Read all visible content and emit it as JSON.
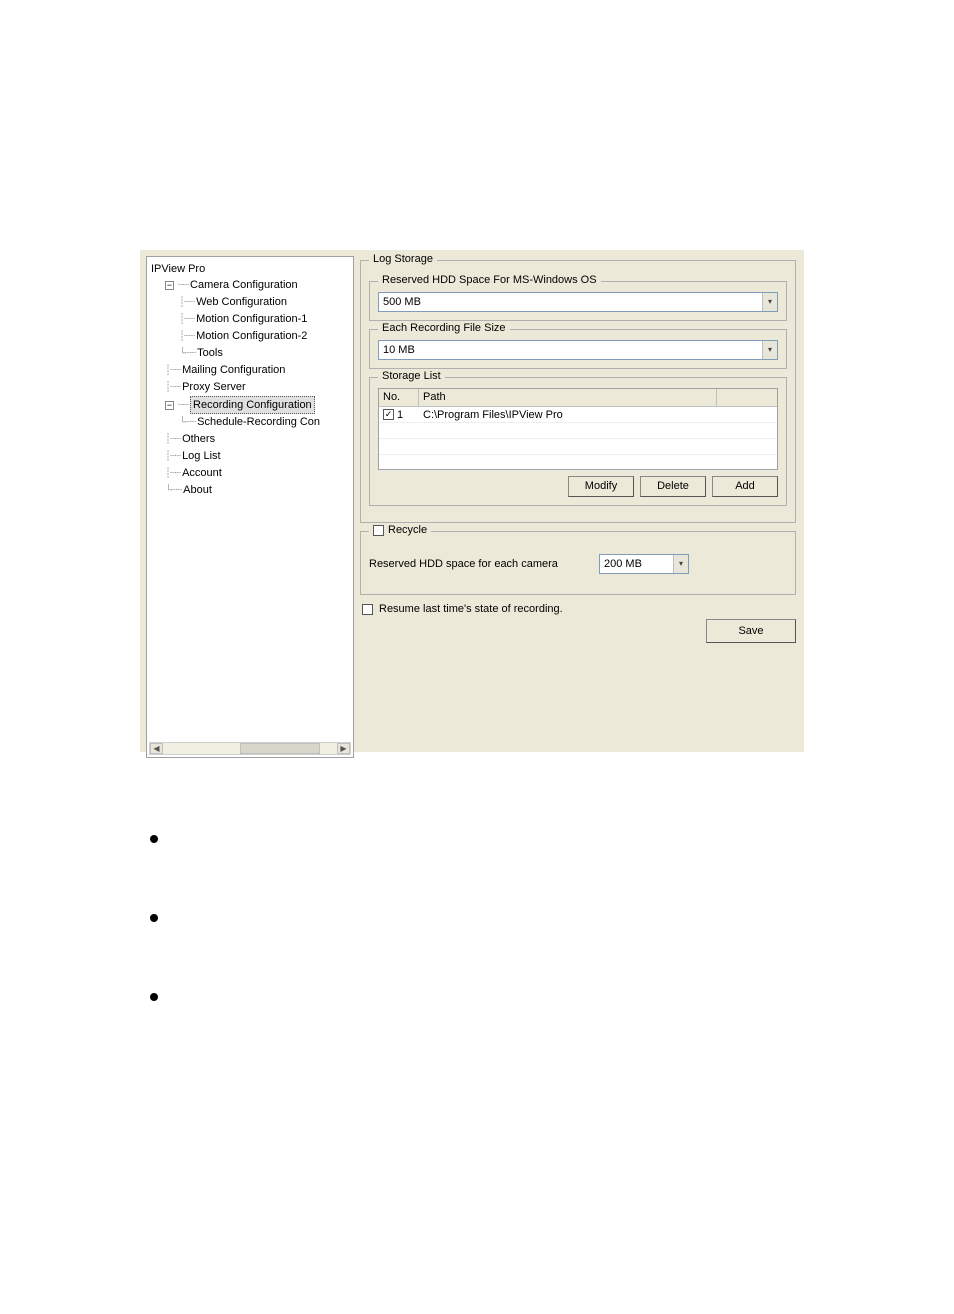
{
  "tree": {
    "root": "IPView Pro",
    "camera_config": "Camera Configuration",
    "web_config": "Web Configuration",
    "motion1": "Motion Configuration-1",
    "motion2": "Motion Configuration-2",
    "tools": "Tools",
    "mailing": "Mailing Configuration",
    "proxy": "Proxy Server",
    "recording": "Recording Configuration",
    "schedule": "Schedule-Recording Con",
    "others": "Others",
    "loglist": "Log List",
    "account": "Account",
    "about": "About"
  },
  "log_storage": {
    "legend": "Log Storage",
    "reserved_legend": "Reserved HDD Space For MS-Windows OS",
    "reserved_value": "500 MB",
    "filesize_legend": "Each Recording File Size",
    "filesize_value": "10 MB",
    "storage_legend": "Storage List",
    "col_no": "No.",
    "col_path": "Path",
    "row1_no": "1",
    "row1_path": "C:\\Program Files\\IPView Pro",
    "btn_modify": "Modify",
    "btn_delete": "Delete",
    "btn_add": "Add"
  },
  "recycle": {
    "legend": "Recycle",
    "label": "Reserved HDD space for each camera",
    "value": "200 MB"
  },
  "resume": {
    "label": "Resume last time's state of recording."
  },
  "save": {
    "label": "Save"
  },
  "expander": "−"
}
